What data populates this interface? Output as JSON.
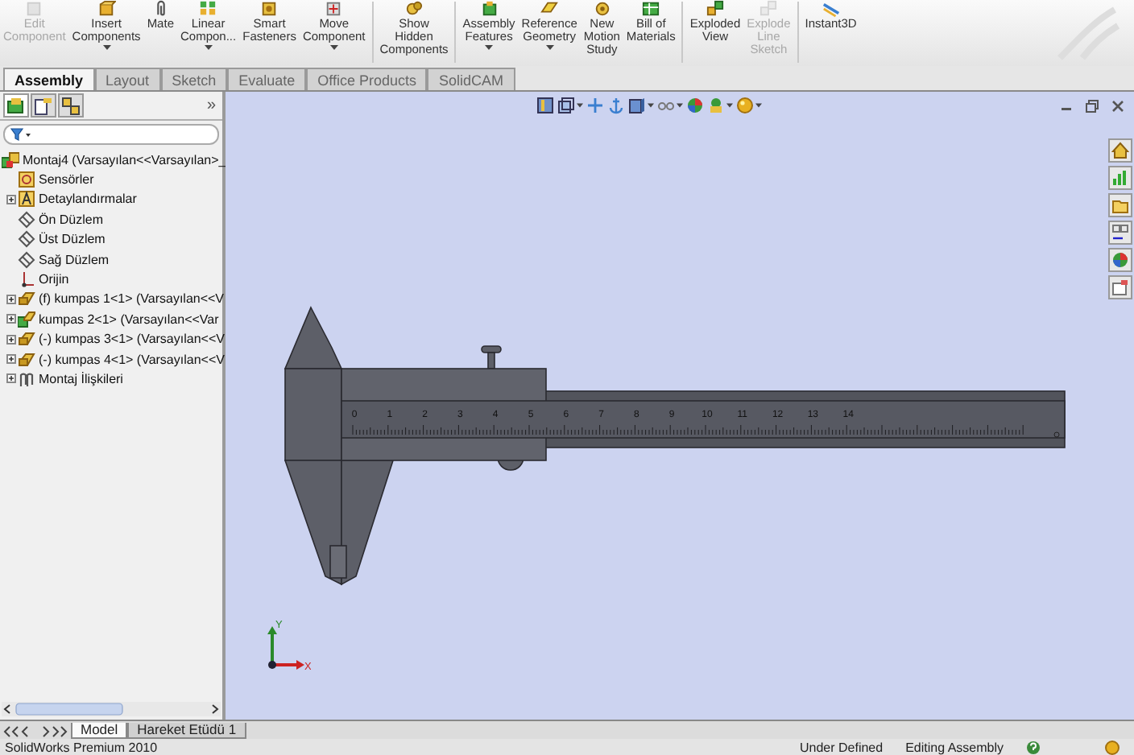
{
  "toolbar": [
    {
      "label": "Edit\nComponent",
      "disabled": true,
      "dropdown": false
    },
    {
      "label": "Insert\nComponents",
      "disabled": false,
      "dropdown": true
    },
    {
      "label": "Mate",
      "disabled": false,
      "dropdown": false
    },
    {
      "label": "Linear\nCompon...",
      "disabled": false,
      "dropdown": true
    },
    {
      "label": "Smart\nFasteners",
      "disabled": false,
      "dropdown": false
    },
    {
      "label": "Move\nComponent",
      "disabled": false,
      "dropdown": true
    },
    {
      "label": "Show\nHidden\nComponents",
      "disabled": false,
      "dropdown": false
    },
    {
      "label": "Assembly\nFeatures",
      "disabled": false,
      "dropdown": true
    },
    {
      "label": "Reference\nGeometry",
      "disabled": false,
      "dropdown": true
    },
    {
      "label": "New\nMotion\nStudy",
      "disabled": false,
      "dropdown": false
    },
    {
      "label": "Bill of\nMaterials",
      "disabled": false,
      "dropdown": false
    },
    {
      "label": "Exploded\nView",
      "disabled": false,
      "dropdown": false
    },
    {
      "label": "Explode\nLine\nSketch",
      "disabled": true,
      "dropdown": false
    },
    {
      "label": "Instant3D",
      "disabled": false,
      "dropdown": false
    }
  ],
  "tabs": [
    {
      "label": "Assembly",
      "selected": true
    },
    {
      "label": "Layout",
      "selected": false
    },
    {
      "label": "Sketch",
      "selected": false
    },
    {
      "label": "Evaluate",
      "selected": false
    },
    {
      "label": "Office Products",
      "selected": false
    },
    {
      "label": "SolidCAM",
      "selected": false
    }
  ],
  "feature_manager": {
    "panel_tabs": [
      {
        "selected": true
      },
      {
        "selected": false
      },
      {
        "selected": false
      }
    ],
    "expand_label": "»",
    "tree": [
      {
        "kind": "assembly",
        "label": "Montaj4  (Varsayılan<<Varsayılan>_",
        "expander": false
      },
      {
        "kind": "sensor",
        "label": "Sensörler",
        "expander": false
      },
      {
        "kind": "annotation",
        "label": "Detaylandırmalar",
        "expander": true
      },
      {
        "kind": "plane",
        "label": "Ön Düzlem",
        "expander": false
      },
      {
        "kind": "plane",
        "label": "Üst Düzlem",
        "expander": false
      },
      {
        "kind": "plane",
        "label": "Sağ Düzlem",
        "expander": false
      },
      {
        "kind": "origin",
        "label": "Orijin",
        "expander": false
      },
      {
        "kind": "part",
        "label": "(f) kumpas 1<1> (Varsayılan<<V",
        "expander": true
      },
      {
        "kind": "subassembly",
        "label": "kumpas 2<1> (Varsayılan<<Var",
        "expander": true
      },
      {
        "kind": "part",
        "label": "(-) kumpas 3<1> (Varsayılan<<V",
        "expander": true
      },
      {
        "kind": "part",
        "label": "(-) kumpas 4<1> (Varsayılan<<V",
        "expander": true
      },
      {
        "kind": "mates",
        "label": "Montaj İlişkileri",
        "expander": true
      }
    ]
  },
  "view_toolbar": [
    {
      "dropdown": false
    },
    {
      "dropdown": true
    },
    {
      "dropdown": false
    },
    {
      "dropdown": false
    },
    {
      "dropdown": true
    },
    {
      "dropdown": true
    },
    {
      "dropdown": false
    },
    {
      "dropdown": true
    },
    {
      "dropdown": true
    }
  ],
  "viewport": {
    "scale_labels": [
      "0",
      "1",
      "2",
      "3",
      "4",
      "5",
      "6",
      "7",
      "8",
      "9",
      "10",
      "11",
      "12",
      "13",
      "14"
    ],
    "axis_labels": [
      "Y",
      "X"
    ]
  },
  "bottom_tabs": [
    {
      "label": "Model",
      "selected": true
    },
    {
      "label": "Hareket Etüdü 1",
      "selected": false
    }
  ],
  "status_bar": {
    "product": "SolidWorks Premium 2010",
    "state": "Under Defined",
    "mode": "Editing Assembly"
  }
}
